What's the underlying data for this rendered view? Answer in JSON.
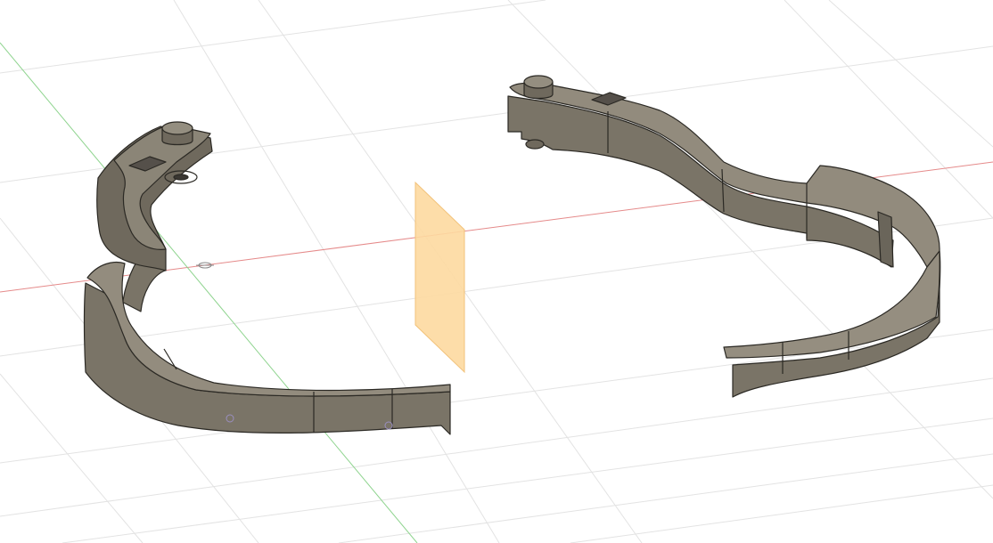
{
  "viewport": {
    "background": "#ffffff",
    "grid_color": "#dcdcdc",
    "x_axis_color": "#e07070",
    "y_axis_color": "#7fcf7f",
    "plane_color": "#fdd9a0",
    "body_fill": "#7a7467",
    "body_top": "#8f887a",
    "body_edge": "#2b2924"
  },
  "objects": [
    {
      "name": "left-temple-arm"
    },
    {
      "name": "right-temple-arm"
    },
    {
      "name": "construction-plane"
    },
    {
      "name": "origin-marker"
    }
  ]
}
